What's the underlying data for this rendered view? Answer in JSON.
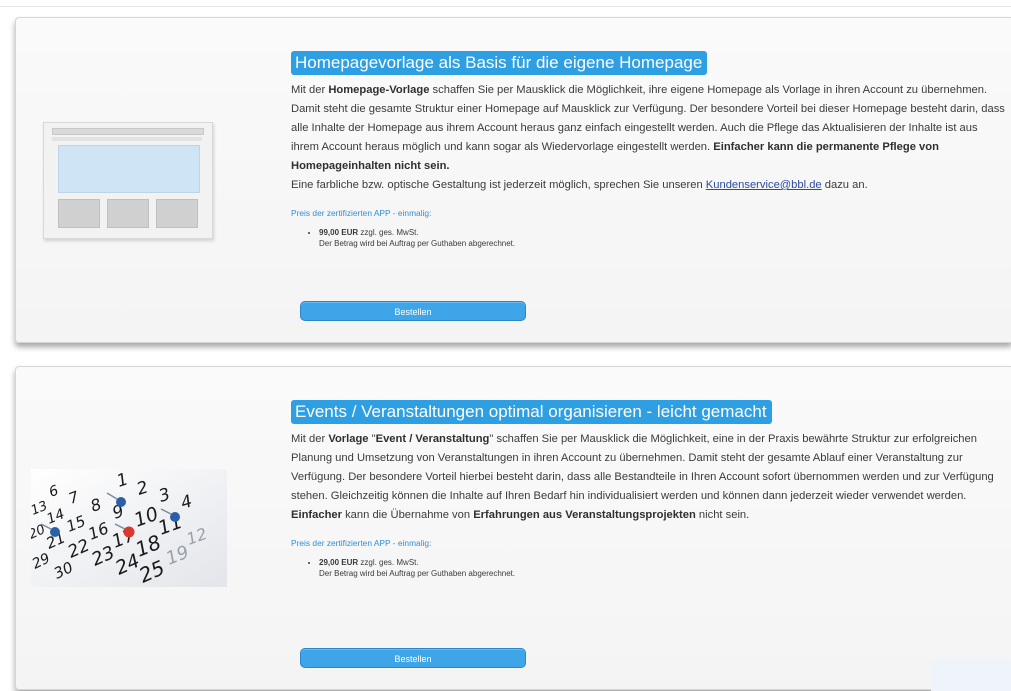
{
  "cards": [
    {
      "title": "Homepagevorlage als Basis für die eigene Homepage",
      "desc": [
        {
          "t": "Mit der ",
          "b": false
        },
        {
          "t": "Homepage-Vorlage",
          "b": true
        },
        {
          "t": " schaffen Sie per Mausklick die Möglichkeit, ihre eigene Homepage als Vorlage in ihren Account zu übernehmen. Damit steht die gesamte Struktur einer Homepage auf Mausklick zur Verfügung. Der besondere Vorteil bei dieser Homepage besteht darin, dass alle Inhalte der Homepage aus ihrem Account heraus ganz einfach eingestellt werden. Auch die Pflege das Aktualisieren der Inhalte ist aus ihrem Account heraus möglich und kann sogar als Wiedervorlage eingestellt werden. ",
          "b": false
        },
        {
          "t": "Einfacher kann die permanente Pflege von Homepageinhalten nicht sein.",
          "b": true
        }
      ],
      "desc_line2": "Eine farbliche bzw. optische Gestaltung ist jederzeit möglich, sprechen Sie unseren ",
      "link_text": "Kundenservice@bbl.de",
      "desc_line2_end": " dazu an.",
      "price_title": "Preis der zertifizierten APP - einmalig:",
      "price_amount": "99,00 EUR",
      "price_tax": " zzgl. ges. MwSt.",
      "price_note": "Der Betrag wird bei Auftrag per Guthaben abgerechnet.",
      "button_label": "Bestellen",
      "image_icon": "homepage-template-icon"
    },
    {
      "title": "Events / Veranstaltungen optimal organisieren - leicht gemacht",
      "desc": [
        {
          "t": "Mit der ",
          "b": false
        },
        {
          "t": "Vorlage",
          "b": true
        },
        {
          "t": " \"",
          "b": false
        },
        {
          "t": "Event / Veranstaltung",
          "b": true
        },
        {
          "t": "\" schaffen Sie per Mausklick die Möglichkeit, eine in der Praxis bewährte Struktur zur erfolgreichen Planung und Umsetzung von Veranstaltungen in ihren Account zu übernehmen. Damit steht der gesamte Ablauf einer Veranstaltung  zur Verfügung. Der besondere Vorteil hierbei besteht darin, dass alle Bestandteile in Ihren Account sofort übernommen werden und zur Verfügung stehen. Gleichzeitig können die Inhalte auf Ihren Bedarf hin individualisiert werden und können dann jederzeit wieder verwendet werden. ",
          "b": false
        },
        {
          "t": "Einfacher",
          "b": true
        },
        {
          "t": " kann die Übernahme von ",
          "b": false
        },
        {
          "t": "Erfahrungen aus Veranstaltungsprojekten",
          "b": true
        },
        {
          "t": " nicht sein.",
          "b": false
        }
      ],
      "price_title": "Preis der zertifizierten APP - einmalig:",
      "price_amount": "29,00 EUR",
      "price_tax": " zzgl. ges. MwSt.",
      "price_note": "Der Betrag wird bei Auftrag per Guthaben abgerechnet.",
      "button_label": "Bestellen",
      "image_icon": "calendar-photo",
      "calendar_numbers": [
        "1",
        "2",
        "3",
        "4",
        "6",
        "7",
        "8",
        "9",
        "10",
        "11",
        "12",
        "13",
        "14",
        "15",
        "16",
        "17",
        "18",
        "19",
        "20",
        "21",
        "22",
        "23",
        "24",
        "25",
        "29",
        "30"
      ]
    }
  ],
  "colors": {
    "accent": "#2f9fe3",
    "button": "#3da5e8",
    "link": "#2b4b9e",
    "pin_blue": "#2c5fa8",
    "pin_red": "#d83a2e"
  }
}
